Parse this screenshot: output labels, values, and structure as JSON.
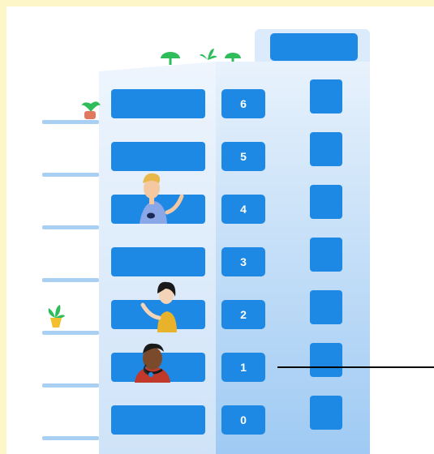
{
  "floors": [
    {
      "label": "6"
    },
    {
      "label": "5"
    },
    {
      "label": "4",
      "occupant": "man-waving"
    },
    {
      "label": "3"
    },
    {
      "label": "2",
      "occupant": "woman-waving"
    },
    {
      "label": "1",
      "occupant": "man-with-headset",
      "pointer": true
    },
    {
      "label": "0"
    }
  ],
  "colors": {
    "background": "#fdf6c8",
    "building_front": "#dcebfb",
    "building_side": "#c2dcf6",
    "window": "#1e88e5",
    "balcony": "#a9cff2",
    "plant": "#2ebd5a",
    "pot": "#e07a5f"
  },
  "icons": [
    "plant-icon",
    "potted-plant-icon",
    "person-illustration"
  ]
}
